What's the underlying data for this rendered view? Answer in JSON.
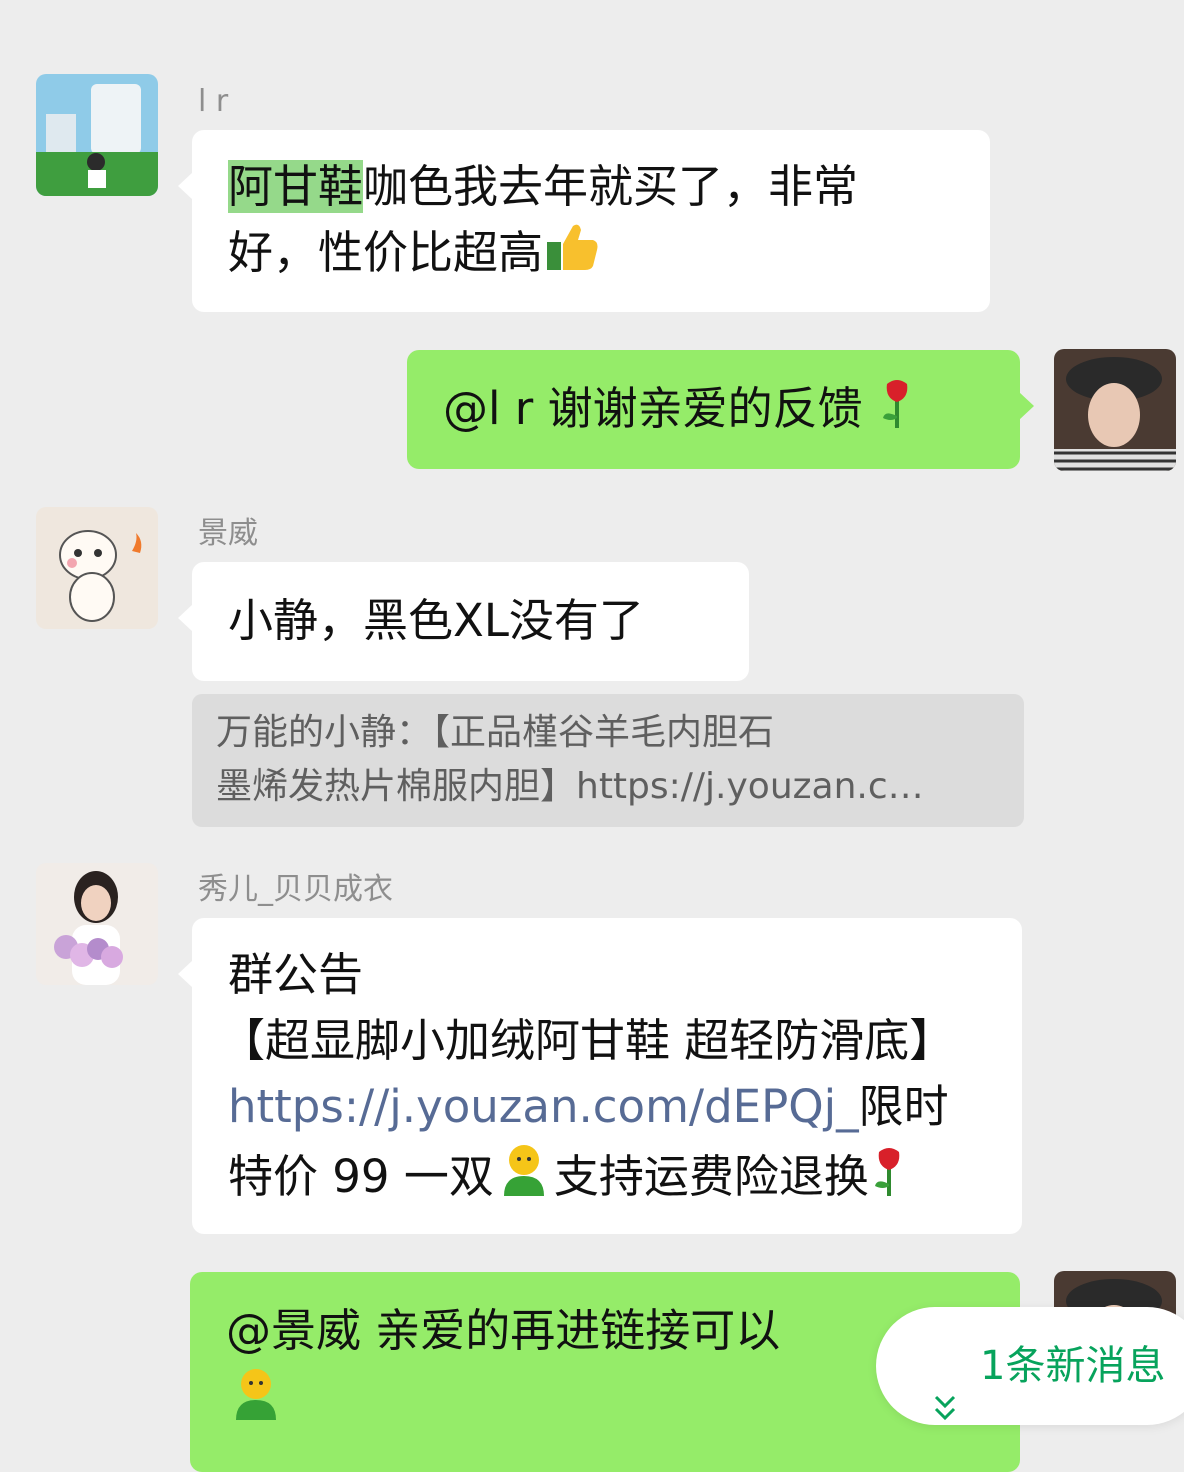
{
  "messages": [
    {
      "sender": "l r",
      "highlight": "阿甘鞋",
      "text_line1": "咖色我去年就买了，非常",
      "text_line2": "好，性价比超高"
    },
    {
      "text": "@l r  谢谢亲爱的反馈"
    },
    {
      "sender": "景威",
      "text": "小静，黑色XL没有了",
      "quote_line1": "万能的小静：【正品槿谷羊毛内胆石",
      "quote_line2": "墨烯发热片棉服内胆】https://j.youzan.c…"
    },
    {
      "sender": "秀儿_贝贝成衣",
      "line1": "群公告",
      "line2": "【超显脚小加绒阿甘鞋 超轻防滑底】",
      "link": "https://j.youzan.com/dEPQj_",
      "link_suffix": "限时",
      "line4_a": "特价 99 一双",
      "line4_b": "支持运费险退换"
    },
    {
      "text": "@景威  亲爱的再进链接可以"
    }
  ],
  "new_message_pill": {
    "label": "1条新消息",
    "icon": "double-chevron-down-icon"
  },
  "colors": {
    "background": "#ededed",
    "incoming": "#ffffff",
    "outgoing": "#95ec69",
    "link": "#576b95",
    "accent": "#07a35c"
  }
}
